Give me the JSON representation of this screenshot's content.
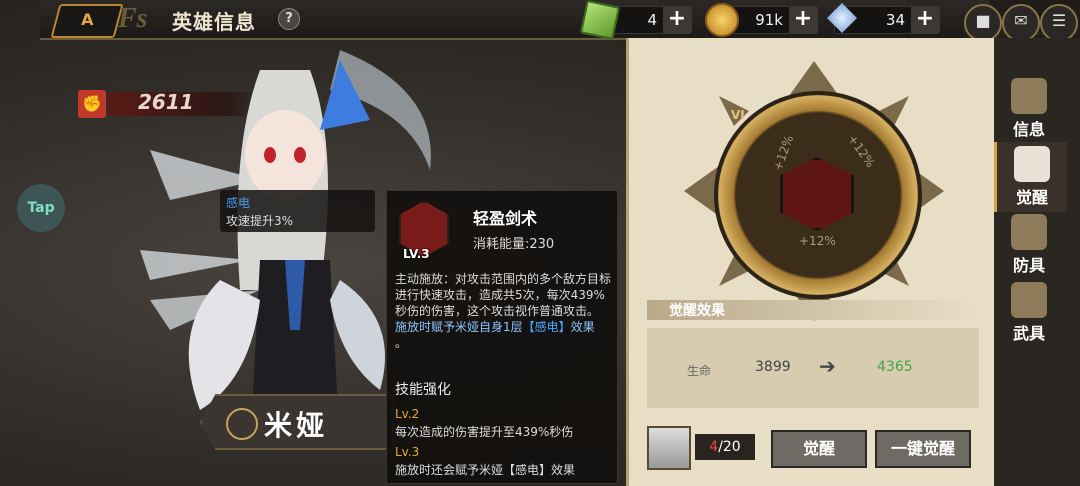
{
  "header": {
    "back_label": "A",
    "title": "英雄信息",
    "help": "?",
    "resources": [
      {
        "icon": "green-gem-icon",
        "value": "4"
      },
      {
        "icon": "gold-coin-icon",
        "value": "91k"
      },
      {
        "icon": "blue-crystal-icon",
        "value": "34"
      }
    ],
    "plus": "+",
    "chat_icon": "chat-icon",
    "mail_icon": "mail-icon",
    "menu_icon": "menu-icon"
  },
  "hero": {
    "power": "2611",
    "name": "米娅",
    "tap_label": "Tap",
    "buff": {
      "name": "感电",
      "desc": "攻速提升3%"
    }
  },
  "skill": {
    "name": "轻盈剑术",
    "level": "LV.3",
    "cost": "消耗能量:230",
    "desc_1": "主动施放：对攻击范围内的多个敌方目标进行快速攻击，造成共5次，每次439%秒伤的伤害，这个攻击视作普通攻击。",
    "desc_2a": "施放时赋予米娅自身1层",
    "desc_2b": "【感电】",
    "desc_2c": "效果",
    "desc_2d": "。",
    "enhance_title": "技能强化",
    "enhancements": [
      {
        "lv": "Lv.2",
        "text": "每次造成的伤害提升至439%秒伤"
      },
      {
        "lv": "Lv.3",
        "text_a": "施放时还会赋予米娅",
        "text_b": "【感电】",
        "text_c": "效果"
      }
    ]
  },
  "awaken": {
    "roman": "VI",
    "segments": [
      "+12%",
      "+12%",
      "+12%"
    ],
    "section_title": "觉醒效果",
    "stat": {
      "label": "生命",
      "before": "3899",
      "arrow": "➔",
      "after": "4365"
    },
    "shard_current": "4",
    "shard_total": "/20",
    "awaken_button": "觉醒",
    "one_click_button": "一键觉醒"
  },
  "side_tabs": [
    {
      "label": "信息",
      "icon": "book-icon"
    },
    {
      "label": "觉醒",
      "icon": "awaken-icon"
    },
    {
      "label": "防具",
      "icon": "armor-icon"
    },
    {
      "label": "武具",
      "icon": "weapon-icon"
    }
  ],
  "colors": {
    "accent": "#d4a44a",
    "buff_blue": "#4aa8ff",
    "gain_green": "#46a04a",
    "panel": "#e8dec6"
  }
}
